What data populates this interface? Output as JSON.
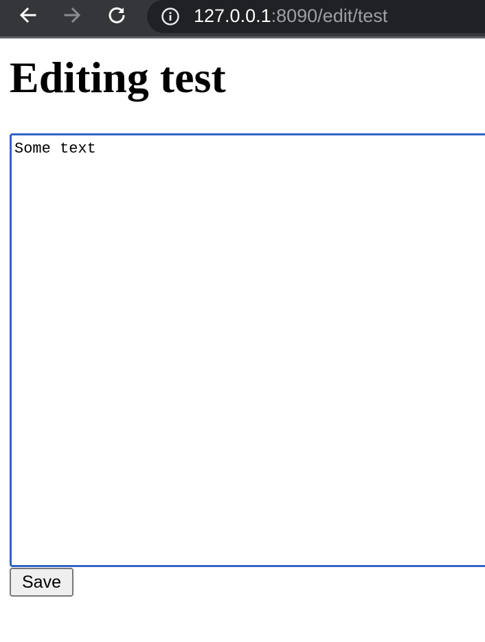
{
  "browser": {
    "url_host": "127.0.0.1",
    "url_rest": ":8090/edit/test",
    "icons": {
      "back": "arrow-left-icon",
      "forward": "arrow-right-icon",
      "reload": "reload-icon",
      "info": "info-icon"
    }
  },
  "page": {
    "title": "Editing test",
    "editor_value": "Some text",
    "save_label": "Save"
  },
  "colors": {
    "toolbar_bg": "#35363a",
    "omnibox_bg": "#202124",
    "focus_border": "#2f63c4"
  }
}
